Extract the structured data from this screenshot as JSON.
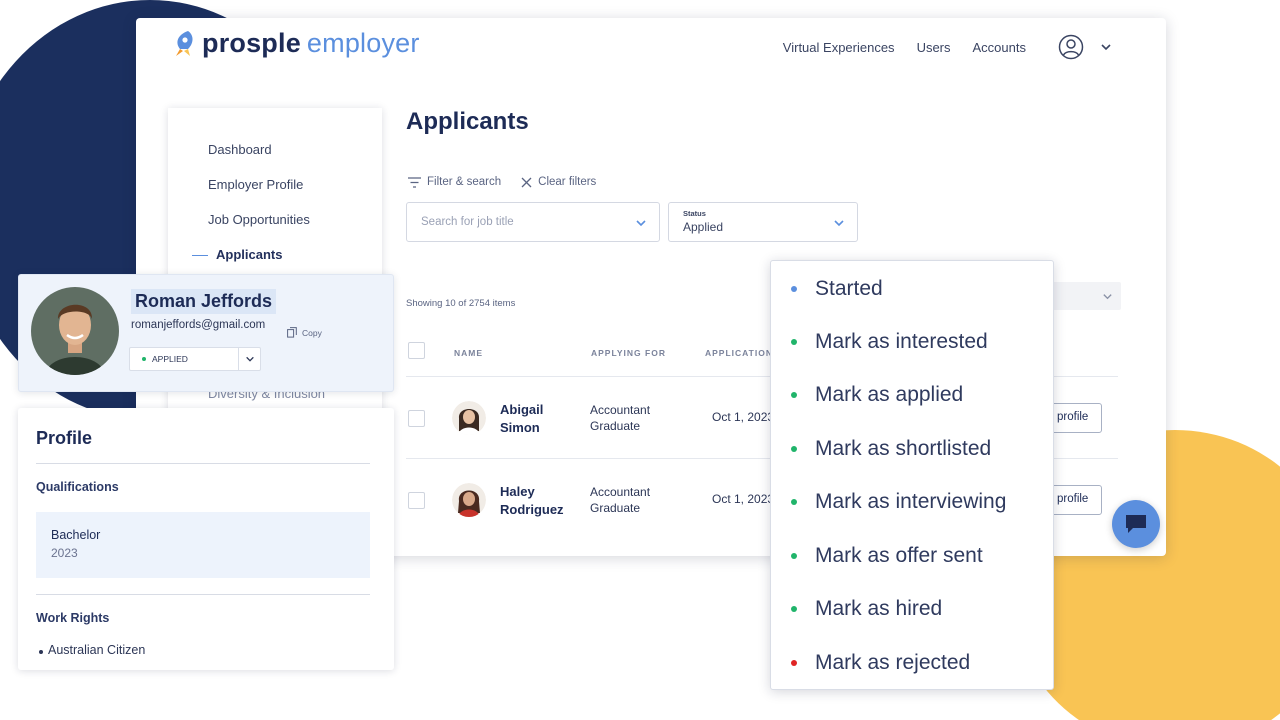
{
  "brand": {
    "word1": "prosple",
    "word2": "employer"
  },
  "topnav": {
    "items": [
      "Virtual Experiences",
      "Users",
      "Accounts"
    ]
  },
  "sidebar": {
    "items": [
      "Dashboard",
      "Employer Profile",
      "Job Opportunities",
      "Applicants",
      "Diversity & Inclusion"
    ]
  },
  "page": {
    "title": "Applicants"
  },
  "filters": {
    "filter_search": "Filter & search",
    "clear": "Clear filters",
    "job_placeholder": "Search for job title",
    "status_label": "Status",
    "status_value": "Applied"
  },
  "showing": "Showing 10 of 2754 items",
  "table": {
    "headers": [
      "NAME",
      "APPLYING FOR",
      "APPLICATION"
    ],
    "rows": [
      {
        "first": "Abigail",
        "last": "Simon",
        "job1": "Accountant",
        "job2": "Graduate",
        "date": "Oct 1, 2023",
        "action": "profile"
      },
      {
        "first": "Haley",
        "last": "Rodriguez",
        "job1": "Accountant",
        "job2": "Graduate",
        "date": "Oct 1, 2023",
        "action": "profile"
      }
    ]
  },
  "candidate": {
    "name": "Roman Jeffords",
    "email": "romanjeffords@gmail.com",
    "copy": "Copy",
    "status": "APPLIED"
  },
  "profile": {
    "title": "Profile",
    "qual_heading": "Qualifications",
    "degree": "Bachelor",
    "year": "2023",
    "work_heading": "Work Rights",
    "work_item": "Australian Citizen"
  },
  "status_menu": {
    "items": [
      {
        "label": "Started",
        "color": "#5b8fde"
      },
      {
        "label": "Mark as interested",
        "color": "#20b46a"
      },
      {
        "label": "Mark as applied",
        "color": "#20b46a"
      },
      {
        "label": "Mark as shortlisted",
        "color": "#20b46a"
      },
      {
        "label": "Mark as interviewing",
        "color": "#20b46a"
      },
      {
        "label": "Mark as offer sent",
        "color": "#20b46a"
      },
      {
        "label": "Mark as hired",
        "color": "#20b46a"
      },
      {
        "label": "Mark as rejected",
        "color": "#e02424"
      }
    ]
  },
  "colors": {
    "navy": "#1b2f5e",
    "accent": "#5b8fde",
    "yellow": "#f9c454",
    "green": "#20b46a",
    "red": "#e02424"
  }
}
